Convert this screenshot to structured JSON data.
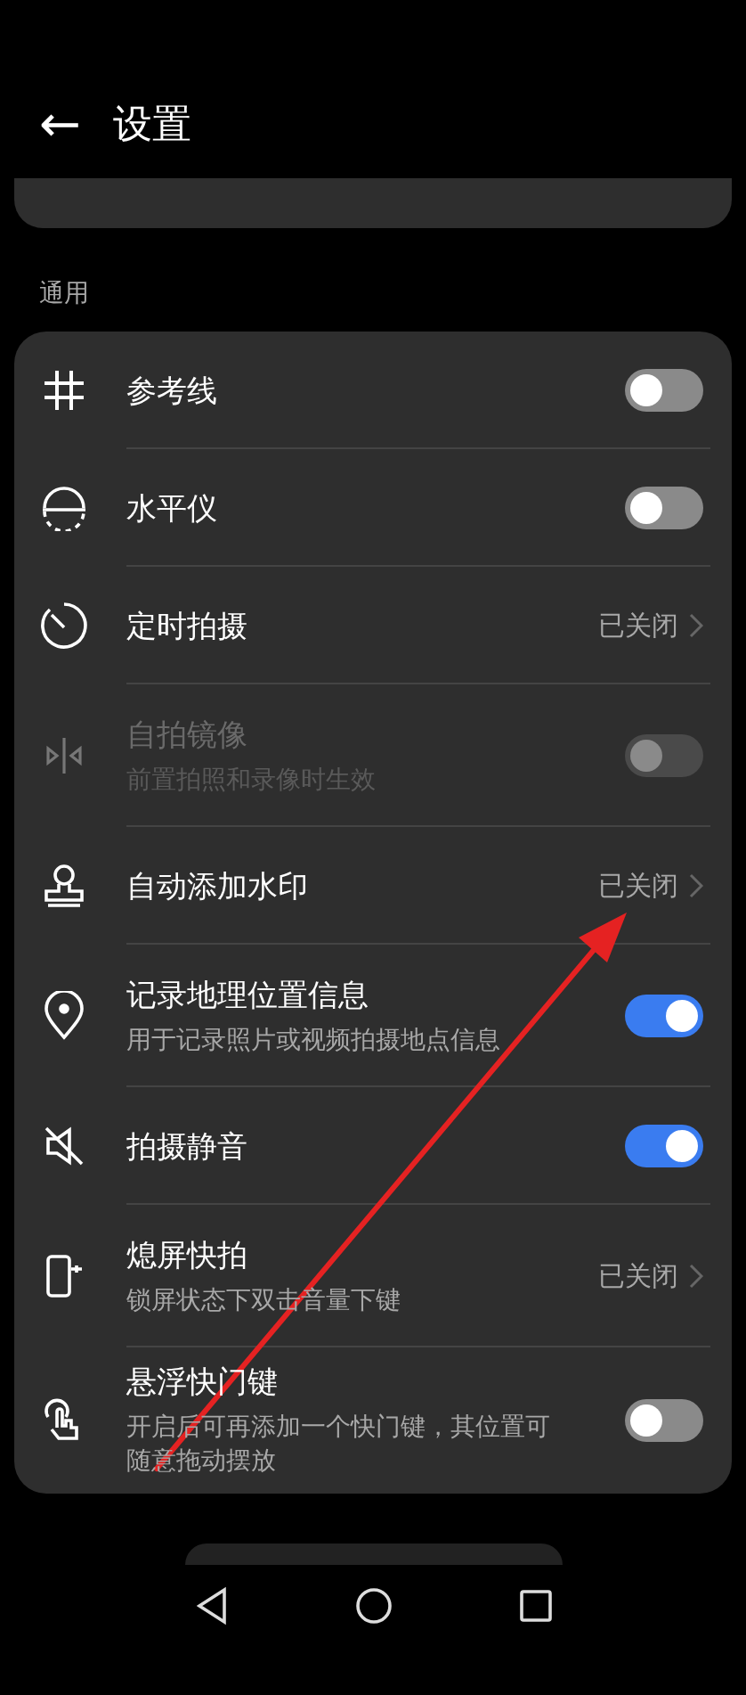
{
  "header": {
    "back": "←",
    "title": "设置"
  },
  "section": "通用",
  "rows": [
    {
      "kind": "toggle",
      "title": "参考线",
      "on": false,
      "disabled": false
    },
    {
      "kind": "toggle",
      "title": "水平仪",
      "on": false,
      "disabled": false
    },
    {
      "kind": "value",
      "title": "定时拍摄",
      "value": "已关闭"
    },
    {
      "kind": "toggle",
      "title": "自拍镜像",
      "subtitle": "前置拍照和录像时生效",
      "on": false,
      "disabled": true
    },
    {
      "kind": "value",
      "title": "自动添加水印",
      "value": "已关闭"
    },
    {
      "kind": "toggle",
      "title": "记录地理位置信息",
      "subtitle": "用于记录照片或视频拍摄地点信息",
      "on": true,
      "disabled": false
    },
    {
      "kind": "toggle",
      "title": "拍摄静音",
      "on": true,
      "disabled": false
    },
    {
      "kind": "value",
      "title": "熄屏快拍",
      "subtitle": "锁屏状态下双击音量下键",
      "value": "已关闭"
    },
    {
      "kind": "toggle",
      "title": "悬浮快门键",
      "subtitle": "开启后可再添加一个快门键，其位置可随意拖动摆放",
      "on": false,
      "disabled": false
    }
  ]
}
